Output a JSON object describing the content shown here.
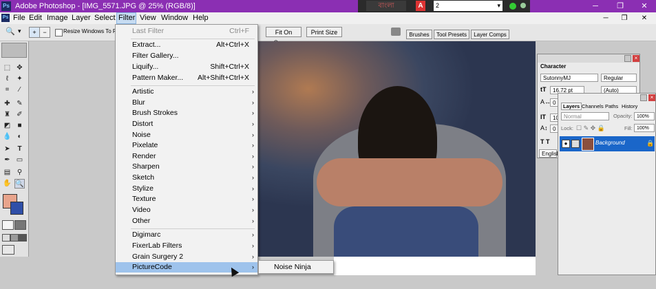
{
  "window": {
    "app_title": "Adobe Photoshop - [IMG_5571.JPG @ 25% (RGB/8)]",
    "logo_text": "Ps",
    "taskbar": {
      "bangla_label": "বাংলা",
      "select_value": "2",
      "select_arrow": "▾"
    },
    "controls": {
      "minimize": "─",
      "maximize": "❐",
      "close": "✕"
    }
  },
  "menubar": {
    "items": [
      "File",
      "Edit",
      "Image",
      "Layer",
      "Select",
      "Filter",
      "View",
      "Window",
      "Help"
    ],
    "active": "Filter",
    "doc_controls": {
      "minimize": "─",
      "restore": "❐",
      "close": "✕"
    }
  },
  "options": {
    "zoom_icon": "🔍",
    "dropdown_arrow": "▾",
    "resize_label": "Resize Windows To Fit",
    "fit_on_screen": "Fit On Screen",
    "print_size": "Print Size",
    "palette_tabs": [
      "Brushes",
      "Tool Presets",
      "Layer Comps"
    ]
  },
  "filter_menu": {
    "last_filter": {
      "label": "Last Filter",
      "shortcut": "Ctrl+F"
    },
    "group1": [
      {
        "label": "Extract...",
        "shortcut": "Alt+Ctrl+X"
      },
      {
        "label": "Filter Gallery...",
        "shortcut": ""
      },
      {
        "label": "Liquify...",
        "shortcut": "Shift+Ctrl+X"
      },
      {
        "label": "Pattern Maker...",
        "shortcut": "Alt+Shift+Ctrl+X"
      }
    ],
    "group2": [
      "Artistic",
      "Blur",
      "Brush Strokes",
      "Distort",
      "Noise",
      "Pixelate",
      "Render",
      "Sharpen",
      "Sketch",
      "Stylize",
      "Texture",
      "Video",
      "Other"
    ],
    "group3": [
      "Digimarc",
      "FixerLab Filters",
      "Grain Surgery 2",
      "PictureCode"
    ],
    "highlighted": "PictureCode",
    "submenu_arrow": "›"
  },
  "submenu": {
    "item": "Noise Ninja"
  },
  "character_panel": {
    "tab": "Character",
    "font": "SutonnyMJ",
    "style": "Regular",
    "size": "16.72 pt",
    "leading": "(Auto)",
    "scale_v": "10",
    "baseline": "0",
    "tracking": "0",
    "language": "English"
  },
  "layers_panel": {
    "tabs": [
      "Layers",
      "Channels",
      "Paths",
      "History"
    ],
    "blend_mode": "Normal",
    "opacity_label": "Opacity:",
    "opacity": "100%",
    "lock_label": "Lock:",
    "fill_label": "Fill:",
    "fill": "100%",
    "layer_name": "Background"
  },
  "colors": {
    "foreground": "#e8a48c",
    "background": "#2f4fa8"
  }
}
